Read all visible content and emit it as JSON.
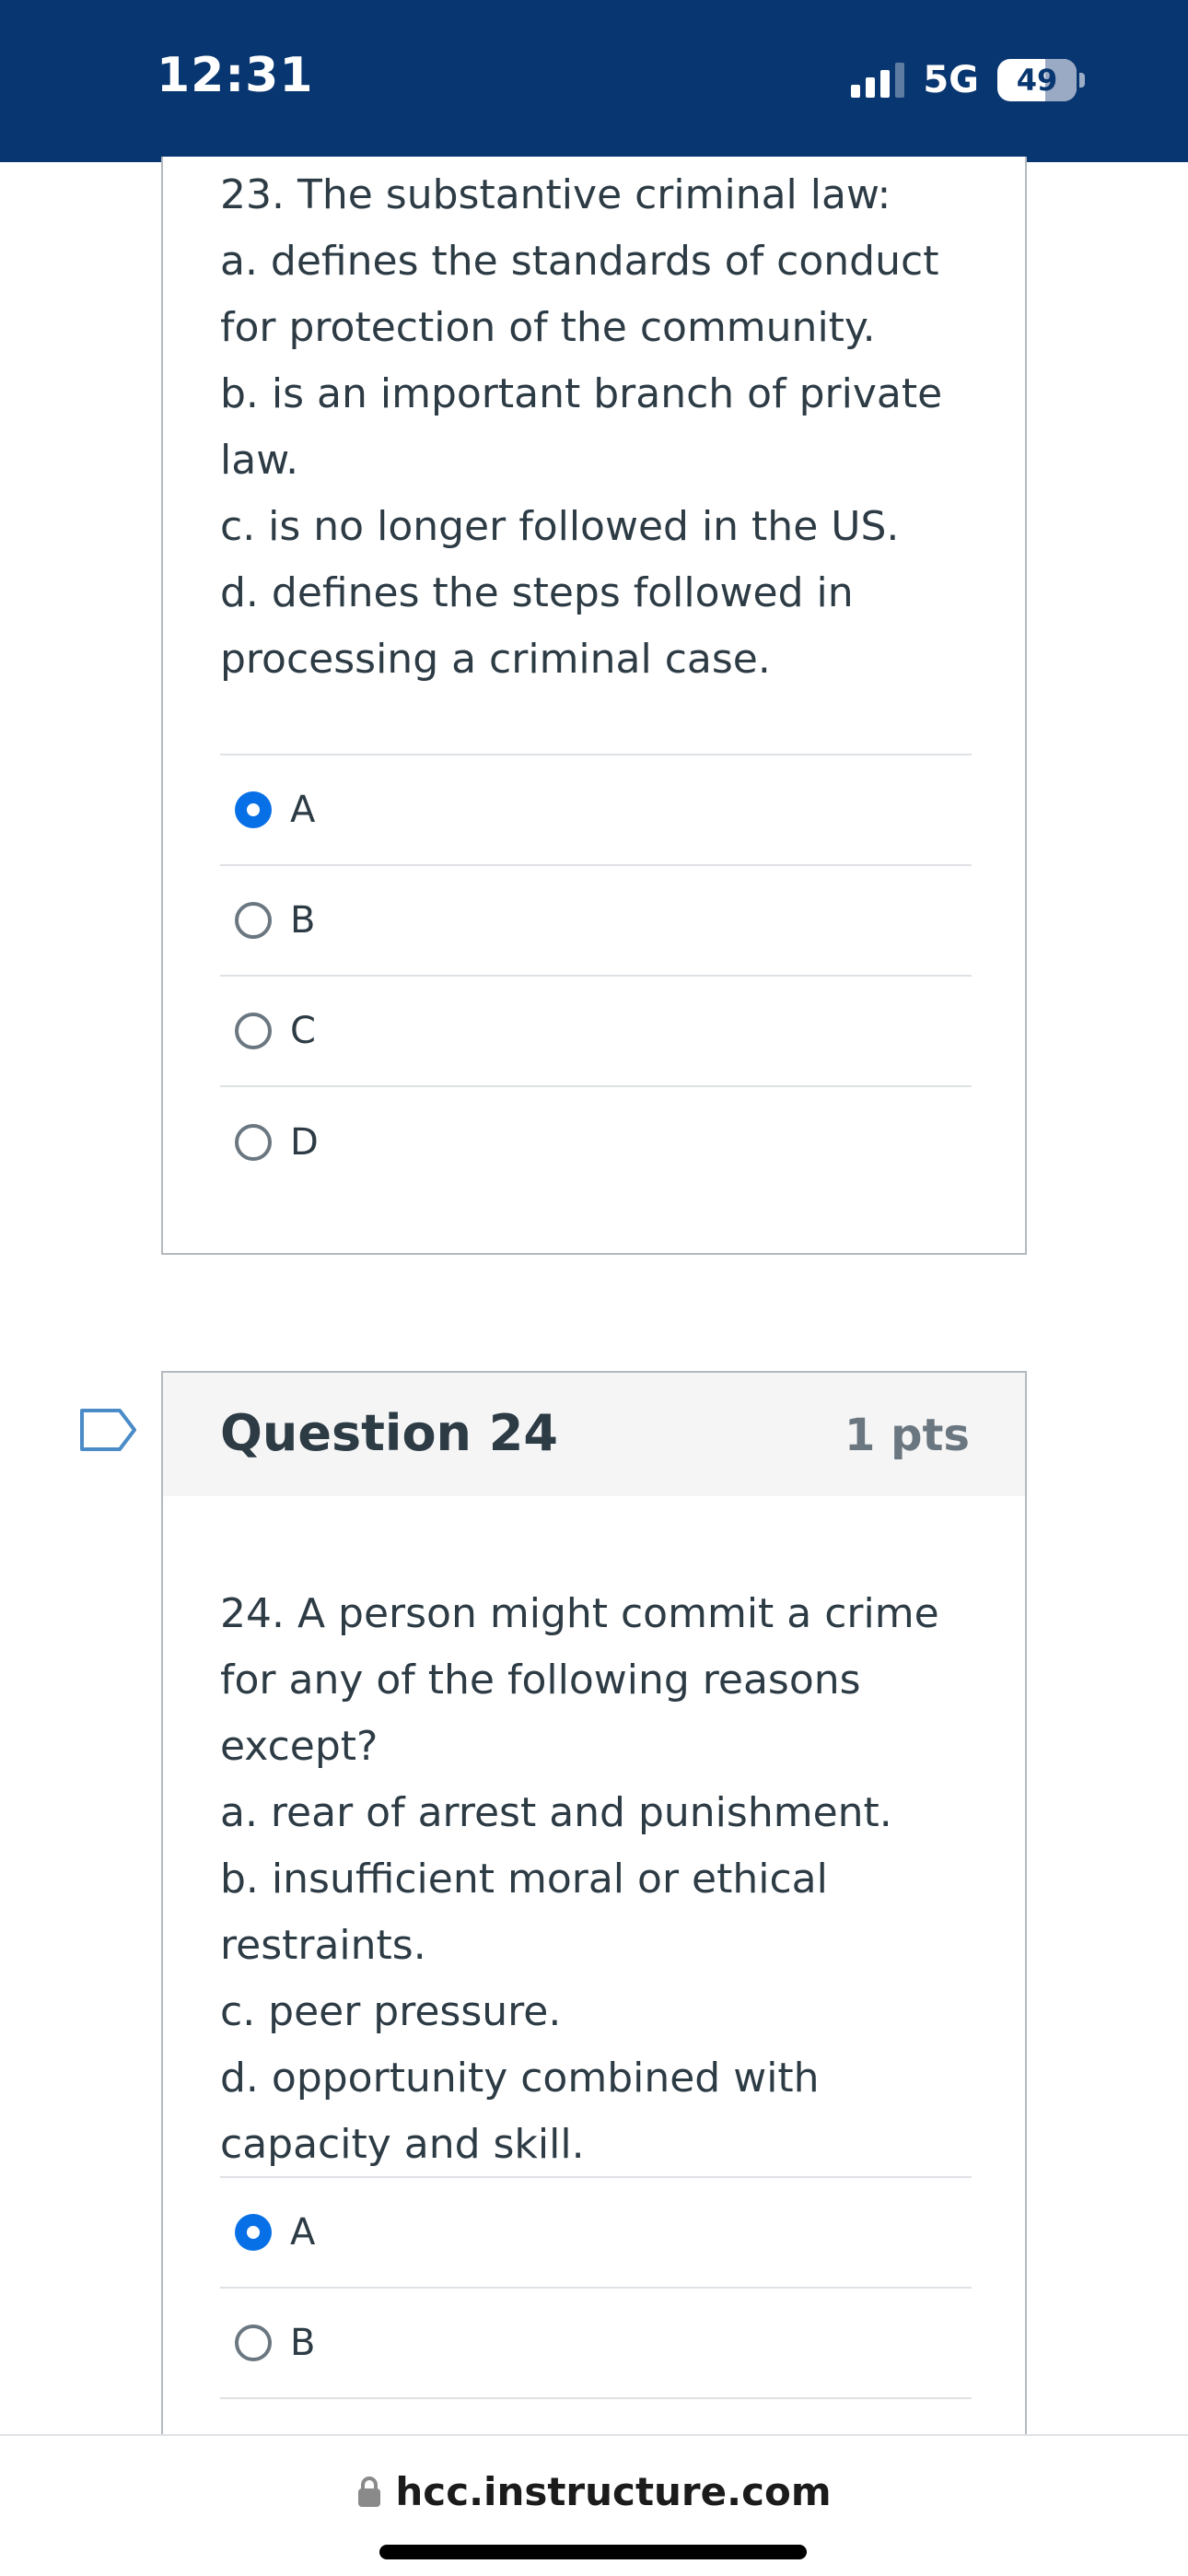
{
  "status_bar": {
    "time": "12:31",
    "network": "5G",
    "battery": "49"
  },
  "question_23": {
    "lines": [
      "23. The substantive criminal law:",
      "a. defines the standards of conduct for protection of the community.",
      "b. is an important branch of private law.",
      "c. is no longer followed in the US.",
      "d. defines the steps followed in processing a criminal case."
    ],
    "answers": [
      {
        "label": "A",
        "selected": true
      },
      {
        "label": "B",
        "selected": false
      },
      {
        "label": "C",
        "selected": false
      },
      {
        "label": "D",
        "selected": false
      }
    ]
  },
  "question_24": {
    "title": "Question 24",
    "points": "1 pts",
    "lines": [
      "24. A person might commit a crime for any of the following reasons except?",
      "a. rear of arrest and punishment.",
      "b. insufficient moral or ethical restraints.",
      "c. peer pressure.",
      "d. opportunity combined with capacity and skill."
    ],
    "answers": [
      {
        "label": "A",
        "selected": true
      },
      {
        "label": "B",
        "selected": false
      }
    ]
  },
  "browser": {
    "url": "hcc.instructure.com"
  },
  "colors": {
    "status_bar": "#083670",
    "radio_selected": "#0770e6"
  }
}
